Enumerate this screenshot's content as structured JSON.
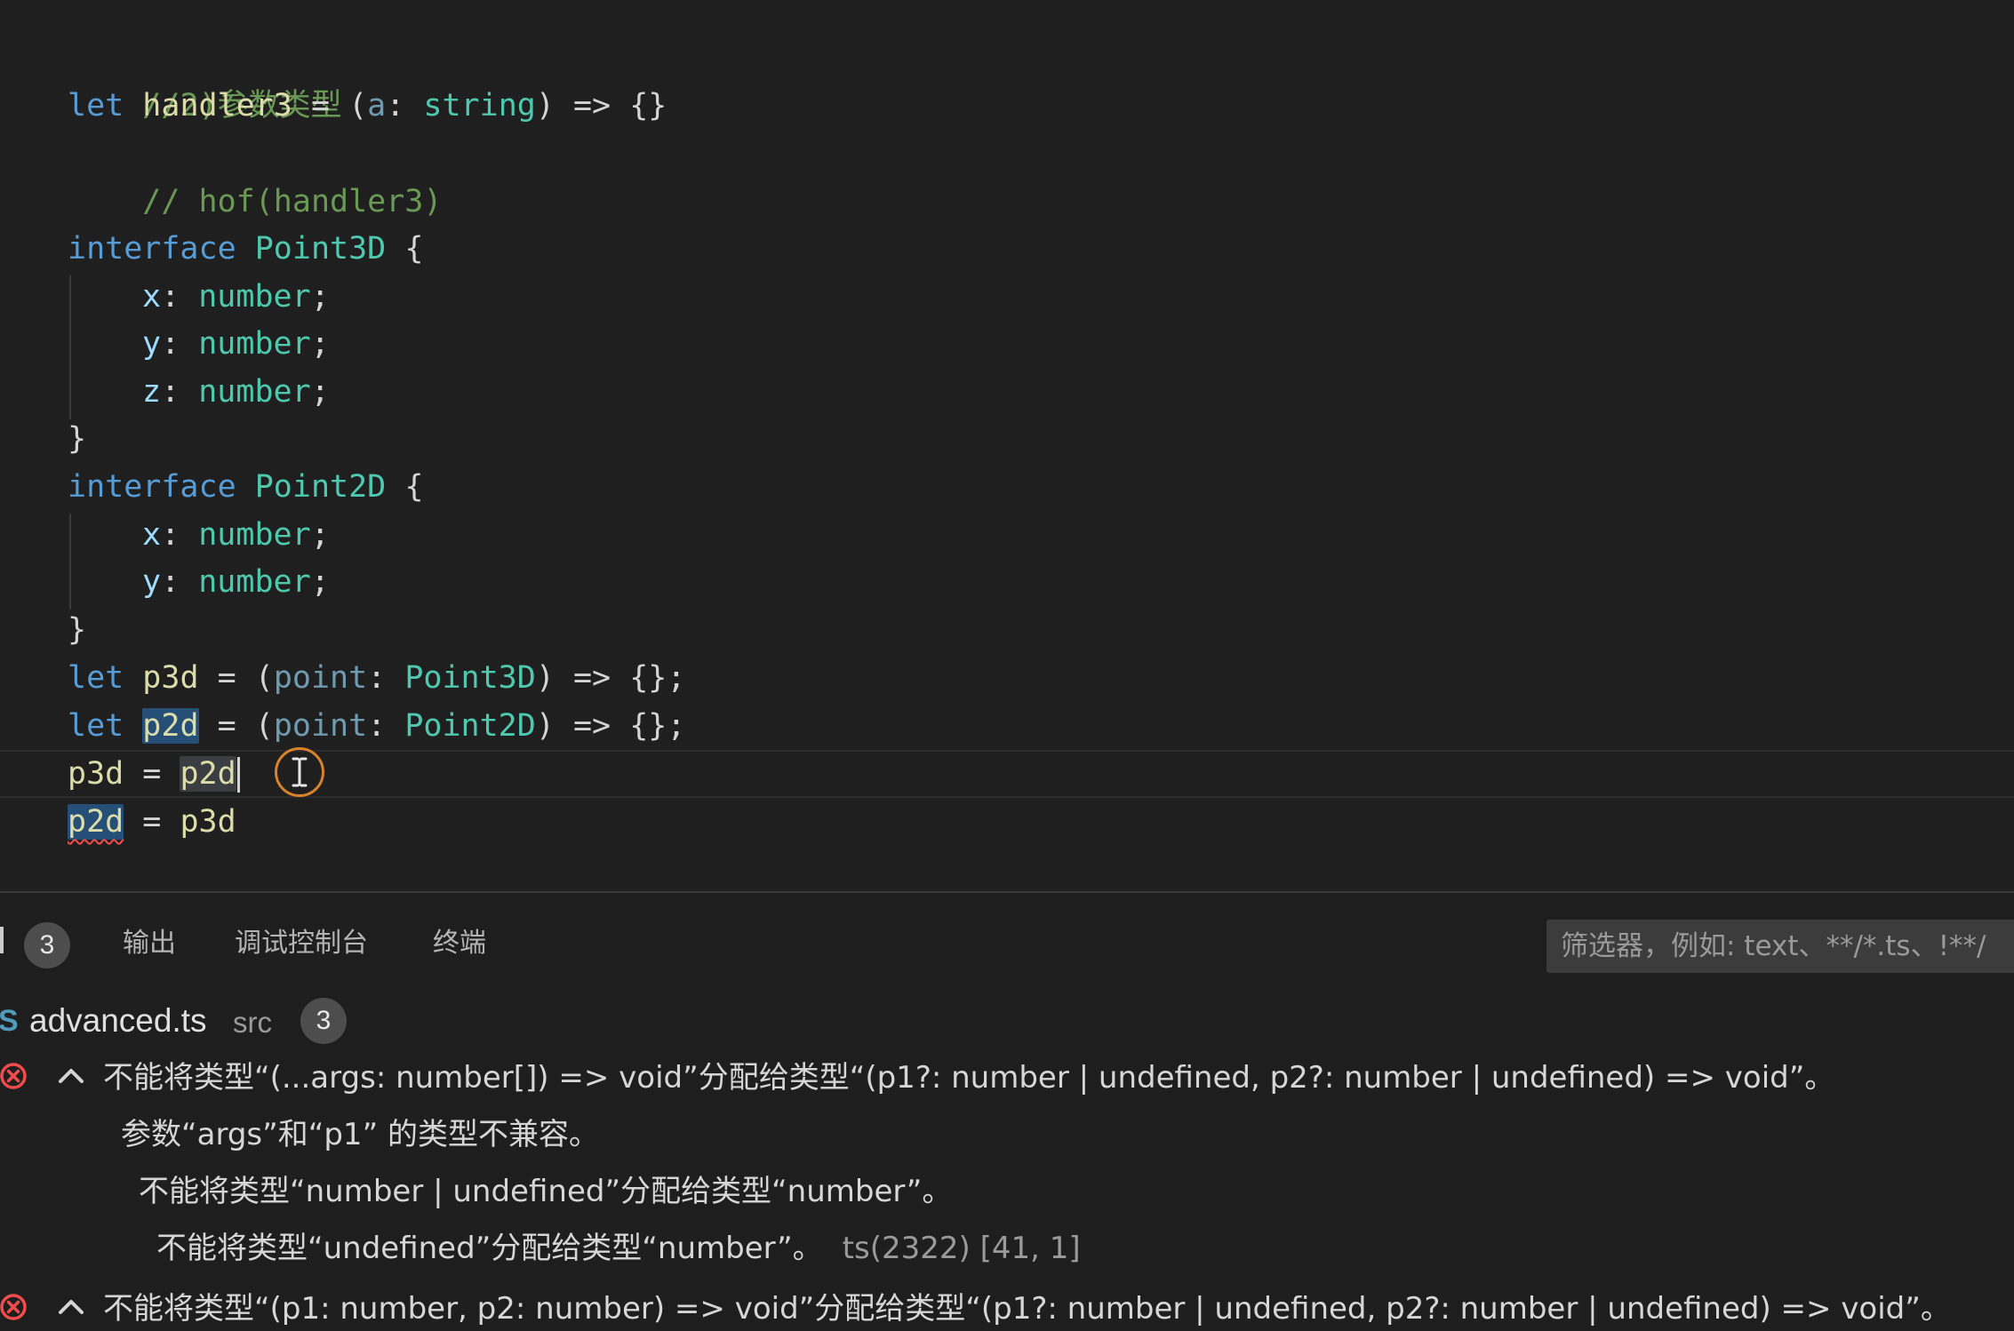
{
  "editor": {
    "lines": {
      "l1_comment": "//2)参数类型",
      "l2_let": "let",
      "l2_name": "handler3",
      "l2_eq": " = (",
      "l2_param": "a",
      "l2_colon": ": ",
      "l2_type": "string",
      "l2_rest": ") => {}",
      "l3_comment": "// hof(handler3)",
      "l5_kw": "interface",
      "l5_name": "Point3D",
      "l5_brace": " {",
      "l6_prop": "x",
      "l6_type": "number",
      "l7_prop": "y",
      "l7_type": "number",
      "l8_prop": "z",
      "l8_type": "number",
      "l9_brace": "}",
      "l10_kw": "interface",
      "l10_name": "Point2D",
      "l10_brace": " {",
      "l11_prop": "x",
      "l11_type": "number",
      "l12_prop": "y",
      "l12_type": "number",
      "l13_brace": "}",
      "l14_let": "let",
      "l14_name": "p3d",
      "l14_param": "point",
      "l14_type": "Point3D",
      "l14_rest": ") => {};",
      "l15_let": "let",
      "l15_name": "p2d",
      "l15_param": "point",
      "l15_type": "Point2D",
      "l15_rest": ") => {};",
      "l16_left": "p3d",
      "l16_eq": " = ",
      "l16_right": "p2d",
      "l17_left": "p2d",
      "l17_eq": " = ",
      "l17_right": "p3d"
    }
  },
  "panel": {
    "problems_count": "3",
    "tabs": {
      "output": "输出",
      "debug_console": "调试控制台",
      "terminal": "终端"
    },
    "filter_placeholder": "筛选器，例如: text、**/*.ts、!**/",
    "file": {
      "icon": "S",
      "name": "advanced.ts",
      "folder": "src",
      "count": "3"
    },
    "problems": [
      {
        "severity": "error",
        "text": "不能将类型“(...args: number[]) => void”分配给类型“(p1?: number | undefined, p2?: number | undefined) => void”。"
      },
      {
        "text": "参数“args”和“p1” 的类型不兼容。"
      },
      {
        "text": "不能将类型“number | undefined”分配给类型“number”。"
      },
      {
        "text": "不能将类型“undefined”分配给类型“number”。",
        "code": "ts(2322) [41, 1]"
      },
      {
        "severity": "error",
        "text": "不能将类型“(p1: number, p2: number) => void”分配给类型“(p1?: number | undefined, p2?: number | undefined) => void”。"
      }
    ]
  },
  "colors": {
    "editor_bg": "#1f1f1f",
    "keyword": "#569cd6",
    "type": "#4ec9b0",
    "comment": "#6a9955",
    "error": "#f14c4c",
    "cursor_marker": "#d9822b"
  },
  "icons": {
    "error": "error-circle-icon",
    "chevron": "chevron-up-icon",
    "cursor": "text-cursor-icon"
  }
}
